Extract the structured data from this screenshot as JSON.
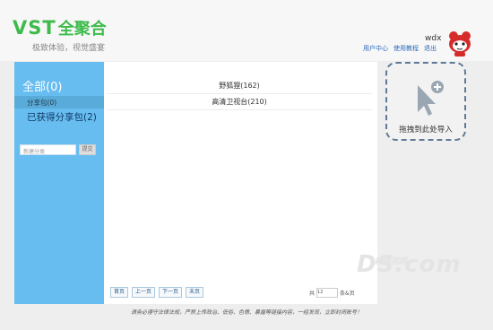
{
  "header": {
    "brand_latin": "VST",
    "brand_cn": "全聚合",
    "slogan": "极致体验，视觉盛宴",
    "username": "wdx",
    "links": [
      "用户中心",
      "使用教程",
      "退出"
    ]
  },
  "sidebar": {
    "all_label": "全部(0)",
    "share_pkg": "分享包(0)",
    "obtained_pkg": "已获得分享包(2)",
    "new_category_placeholder": "新建分类",
    "submit_label": "提交"
  },
  "list": {
    "items": [
      "野狐狸(162)",
      "高清卫视台(210)"
    ]
  },
  "pager": {
    "first": "首页",
    "prev": "上一页",
    "next": "下一页",
    "last": "末页",
    "pre_label": "共",
    "select_value": "12",
    "post_label": "条&页"
  },
  "drop_zone": {
    "label": "拖拽到此处导入"
  },
  "watermark": {
    "big": "DS.com",
    "small": "能电视网"
  },
  "footer": {
    "notice": "请务必遵守法律法规，严禁上传政治、低俗、色情、暴露等链接内容，一经发现，立即封闭账号！"
  },
  "colors": {
    "brand_green": "#3dbb4a",
    "sidebar_blue": "#68bdf0",
    "link_blue": "#2b6bb8"
  }
}
